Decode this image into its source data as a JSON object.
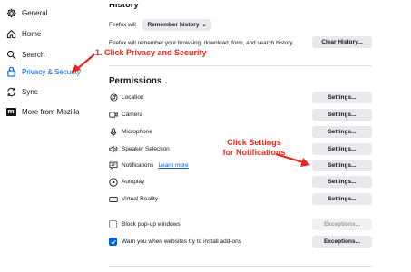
{
  "sidebar": {
    "items": [
      {
        "label": "General",
        "icon": "gear-icon"
      },
      {
        "label": "Home",
        "icon": "home-icon"
      },
      {
        "label": "Search",
        "icon": "search-icon"
      },
      {
        "label": "Privacy & Security",
        "icon": "lock-icon",
        "active": true
      },
      {
        "label": "Sync",
        "icon": "sync-icon"
      },
      {
        "label": "More from Mozilla",
        "icon": "mozilla-icon",
        "badge": "m"
      }
    ]
  },
  "history": {
    "title": "History",
    "firefox_will": "Firefox will",
    "mode_select": "Remember history",
    "description": "Firefox will remember your browsing, download, form, and search history.",
    "clear_button": "Clear History..."
  },
  "permissions": {
    "title": "Permissions",
    "rows": [
      {
        "label": "Location",
        "icon": "location-icon",
        "button": "Settings..."
      },
      {
        "label": "Camera",
        "icon": "camera-icon",
        "button": "Settings..."
      },
      {
        "label": "Microphone",
        "icon": "microphone-icon",
        "button": "Settings..."
      },
      {
        "label": "Speaker Selection",
        "icon": "speaker-icon",
        "button": "Settings..."
      },
      {
        "label": "Notifications",
        "icon": "notification-icon",
        "link": "Learn more",
        "button": "Settings..."
      },
      {
        "label": "Autoplay",
        "icon": "autoplay-icon",
        "button": "Settings..."
      },
      {
        "label": "Virtual Reality",
        "icon": "vr-icon",
        "button": "Settings..."
      }
    ],
    "block_popups": {
      "label": "Block pop-up windows",
      "checked": false,
      "button": "Exceptions..."
    },
    "warn_addons": {
      "label": "Warn you when websites try to install add-ons",
      "checked": true,
      "button": "Exceptions..."
    }
  },
  "annotations": {
    "step1": "1. Click Privacy and Security",
    "step2_line1": "Click Settings",
    "step2_line2": "for Notifications",
    "color": "#e8261b"
  },
  "colors": {
    "accent": "#0060df",
    "button_bg": "#e9e9ed"
  }
}
